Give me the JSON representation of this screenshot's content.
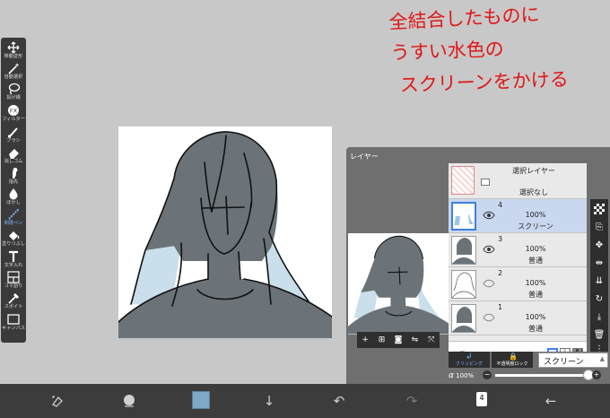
{
  "toolbar": {
    "tools": [
      {
        "label": "移動変形",
        "icon": "move-arrows-icon"
      },
      {
        "label": "自動選択",
        "icon": "magic-wand-icon"
      },
      {
        "label": "投げ縄",
        "icon": "lasso-icon"
      },
      {
        "label": "フィルター",
        "icon": "fx-icon"
      },
      {
        "label": "ブラシ",
        "icon": "brush-icon"
      },
      {
        "label": "消しゴム",
        "icon": "eraser-icon"
      },
      {
        "label": "指先",
        "icon": "smudge-finger-icon"
      },
      {
        "label": "ぼかし",
        "icon": "blur-drop-icon"
      },
      {
        "label": "制限ペン",
        "icon": "limit-pen-icon"
      },
      {
        "label": "塗りつぶし",
        "icon": "fill-bucket-icon"
      },
      {
        "label": "文字入れ",
        "icon": "text-t-icon"
      },
      {
        "label": "コマ割り",
        "icon": "frame-divide-icon"
      },
      {
        "label": "スポイト",
        "icon": "eyedropper-icon"
      },
      {
        "label": "キャンバス",
        "icon": "canvas-icon"
      }
    ],
    "active_index": 8
  },
  "annotation": {
    "lines": [
      "全結合したものに",
      "うすい水色の",
      "スクリーンをかける"
    ],
    "color": "#e01616"
  },
  "layer_panel": {
    "title": "レイヤー",
    "selection_layer": {
      "title": "選択レイヤー",
      "status": "選択なし"
    },
    "layers": [
      {
        "number": "4",
        "opacity": "100%",
        "mode": "スクリーン",
        "selected": true
      },
      {
        "number": "3",
        "opacity": "100%",
        "mode": "普通",
        "selected": false
      },
      {
        "number": "2",
        "opacity": "100%",
        "mode": "普通",
        "selected": false
      },
      {
        "number": "1",
        "opacity": "100%",
        "mode": "普通",
        "selected": false
      }
    ],
    "background_label": "背景",
    "clipping_label": "クリッピング",
    "lock_label": "不透明度ロック",
    "blend_mode": "スクリーン",
    "alpha_label": "α",
    "alpha_value": "100%",
    "alpha_fraction": 1.0,
    "minus": "−",
    "plus": "+"
  },
  "bottom_bar": {
    "color_hex": "#7fa7c6",
    "layer_count": "4"
  },
  "colors": {
    "skin_fill": "#6b7379",
    "hair_light": "#c9dfeb",
    "accent_blue": "#4a8df0"
  }
}
